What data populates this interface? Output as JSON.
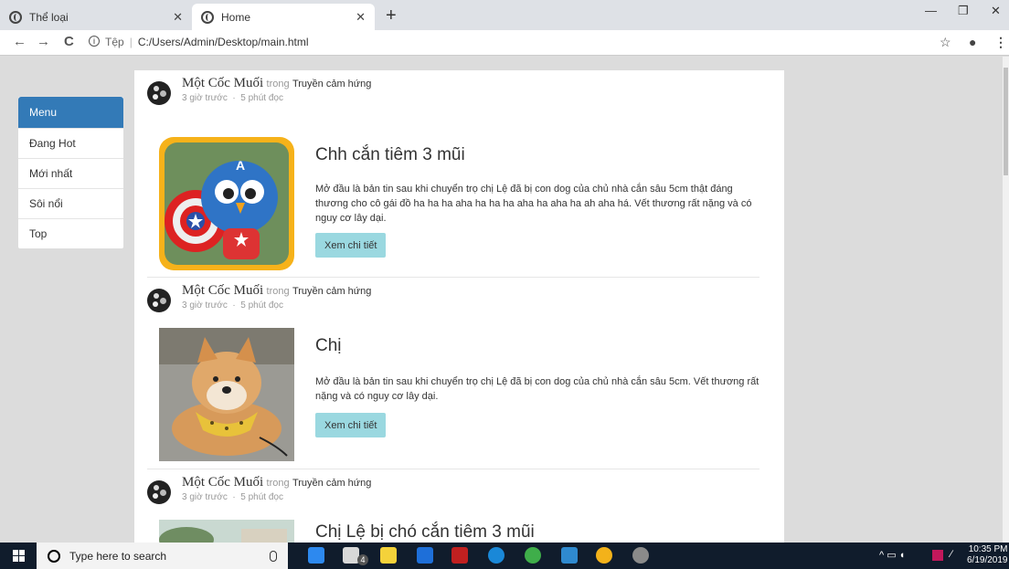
{
  "browser": {
    "tabs": [
      {
        "label": "Thể loại"
      },
      {
        "label": "Home"
      }
    ],
    "new_tab": "+",
    "url_prefix": "Tệp",
    "url": "C:/Users/Admin/Desktop/main.html"
  },
  "menu": {
    "header": "Menu",
    "items": [
      {
        "label": "Đang Hot"
      },
      {
        "label": "Mới nhất"
      },
      {
        "label": "Sôi nổi"
      },
      {
        "label": "Top"
      }
    ]
  },
  "posts": [
    {
      "author": "Một Cốc Muối",
      "trong": "trong",
      "category": "Truyền cảm hứng",
      "time": "3 giờ trước",
      "read": "5 phút đọc",
      "title": "Chh cắn tiêm 3 mũi",
      "excerpt": "Mở đầu là bản tin sau khi chuyển trọ chị Lệ đã bị con dog của chủ nhà cắn sâu 5cm thật đáng thương cho cô gái đồ ha ha ha aha ha ha ha aha ha aha ha ah aha há. Vết thương rất nặng và có nguy cơ lây dại.",
      "button": "Xem chi tiết"
    },
    {
      "author": "Một Cốc Muối",
      "trong": "trong",
      "category": "Truyền cảm hứng",
      "time": "3 giờ trước",
      "read": "5 phút đọc",
      "title": "Chị",
      "excerpt": "Mở đầu là bản tin sau khi chuyển trọ chị Lệ đã bị con dog của chủ nhà cắn sâu 5cm. Vết thương rất nặng và có nguy cơ lây dại.",
      "button": "Xem chi tiết"
    },
    {
      "author": "Một Cốc Muối",
      "trong": "trong",
      "category": "Truyền cảm hứng",
      "time": "3 giờ trước",
      "read": "5 phút đọc",
      "title": "Chị Lệ bị chó cắn tiêm 3 mũi"
    }
  ],
  "taskbar": {
    "search_placeholder": "Type here to search",
    "mail_badge": "4",
    "time": "10:35 PM",
    "date": "6/19/2019"
  }
}
